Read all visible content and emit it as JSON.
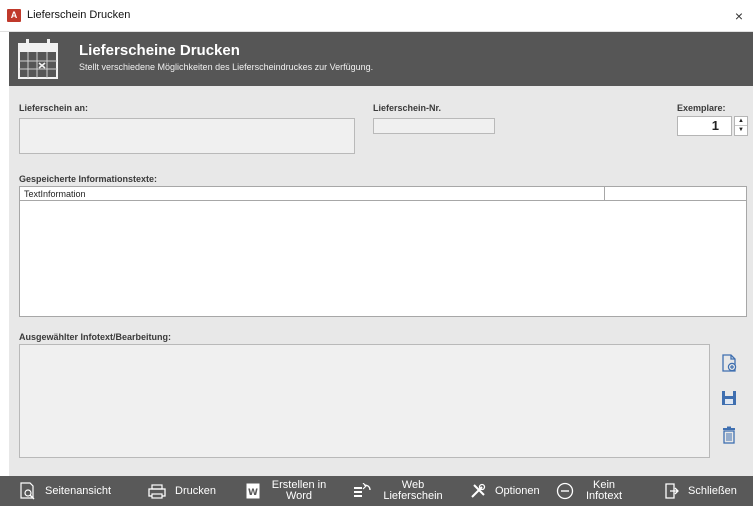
{
  "window": {
    "icon_text": "A",
    "title": "Lieferschein Drucken",
    "close_glyph": "×"
  },
  "header": {
    "title": "Lieferscheine Drucken",
    "subtitle": "Stellt verschiedene Möglichkeiten des Lieferscheindruckes zur Verfügung.",
    "icon": "calendar-icon"
  },
  "form": {
    "recipient_label": "Lieferschein an:",
    "recipient_value": "",
    "number_label": "Lieferschein-Nr.",
    "number_value": "",
    "copies_label": "Exemplare:",
    "copies_value": "1",
    "spin_up": "▲",
    "spin_down": "▼"
  },
  "saved_texts": {
    "label": "Gespeicherte Informationstexte:",
    "columns": [
      "TextInformation",
      ""
    ],
    "rows": []
  },
  "editor": {
    "label": "Ausgewählter Infotext/Bearbeitung:",
    "value": "",
    "side_icons": [
      "new-document-icon",
      "save-icon",
      "delete-icon"
    ]
  },
  "toolbar": {
    "items": [
      {
        "label": "Seitenansicht",
        "icon": "page-preview-icon"
      },
      {
        "label": "Drucken",
        "icon": "printer-icon"
      },
      {
        "label": "Erstellen in Word",
        "icon": "word-icon"
      },
      {
        "label": "Web Lieferschein",
        "icon": "web-document-icon"
      },
      {
        "label": "Optionen",
        "icon": "tools-icon"
      },
      {
        "label": "Kein Infotext",
        "icon": "minus-circle-icon"
      },
      {
        "label": "Schließen",
        "icon": "exit-icon"
      }
    ]
  },
  "colors": {
    "header_bg": "#565656",
    "content_bg": "#e8e8e8",
    "toolbar_bg": "#595959",
    "side_icon_color": "#3f6fb0"
  }
}
